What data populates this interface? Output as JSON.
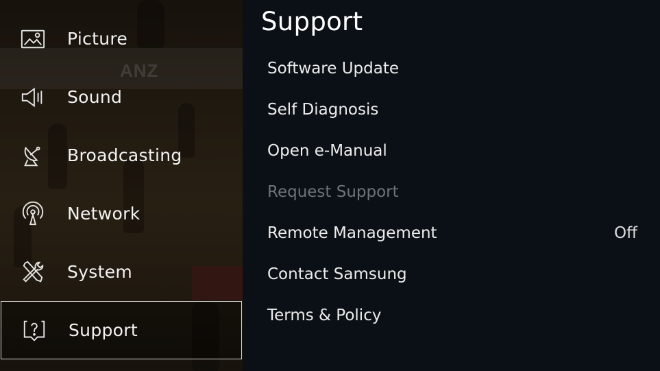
{
  "side_menu": {
    "items": [
      {
        "label": "Picture",
        "icon": "picture-icon"
      },
      {
        "label": "Sound",
        "icon": "speaker-icon"
      },
      {
        "label": "Broadcasting",
        "icon": "satellite-dish-icon"
      },
      {
        "label": "Network",
        "icon": "network-broadcast-icon"
      },
      {
        "label": "System",
        "icon": "tools-icon"
      },
      {
        "label": "Support",
        "icon": "help-icon",
        "selected": true
      }
    ]
  },
  "background": {
    "sponsor_text": "ANZ"
  },
  "panel": {
    "title": "Support",
    "options": [
      {
        "label": "Software Update",
        "value": "",
        "enabled": true
      },
      {
        "label": "Self Diagnosis",
        "value": "",
        "enabled": true
      },
      {
        "label": "Open e-Manual",
        "value": "",
        "enabled": true
      },
      {
        "label": "Request Support",
        "value": "",
        "enabled": false
      },
      {
        "label": "Remote Management",
        "value": "Off",
        "enabled": true
      },
      {
        "label": "Contact Samsung",
        "value": "",
        "enabled": true
      },
      {
        "label": "Terms & Policy",
        "value": "",
        "enabled": true
      }
    ]
  },
  "colors": {
    "panel_background": "#0b1016",
    "text": "#ececec",
    "disabled_text": "#6e7379",
    "selection_border": "#d8d8d8"
  }
}
